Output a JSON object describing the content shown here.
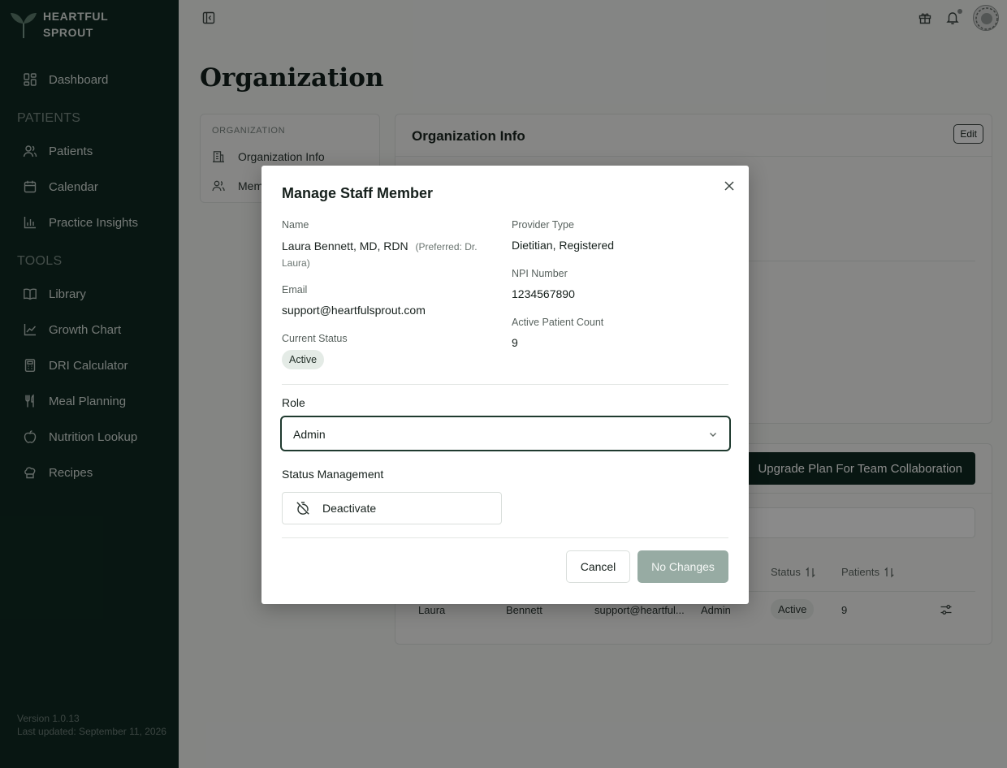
{
  "brand": {
    "line1": "HEARTFUL",
    "line2": "SPROUT"
  },
  "sidebar": {
    "dashboard": "Dashboard",
    "patients_section": "PATIENTS",
    "patients": "Patients",
    "calendar": "Calendar",
    "insights": "Practice Insights",
    "tools_section": "TOOLS",
    "library": "Library",
    "growth": "Growth Chart",
    "dri": "DRI Calculator",
    "meal": "Meal Planning",
    "nutrition": "Nutrition Lookup",
    "recipes": "Recipes",
    "version": "Version 1.0.13",
    "updated": "Last updated: September 11, 2026"
  },
  "page": {
    "title": "Organization"
  },
  "left_panel": {
    "section": "ORGANIZATION",
    "item1": "Organization Info",
    "item2": "Mem"
  },
  "info_panel": {
    "title": "Organization Info",
    "edit": "Edit"
  },
  "members": {
    "upgrade": "Upgrade Plan For Team Collaboration",
    "col_status": "Status",
    "col_patients": "Patients",
    "row": {
      "first": "Laura",
      "last": "Bennett",
      "email": "support@heartful...",
      "role": "Admin",
      "status": "Active",
      "patients": "9"
    }
  },
  "modal": {
    "title": "Manage Staff Member",
    "name_label": "Name",
    "name_value": "Laura Bennett, MD, RDN",
    "preferred": "(Preferred: Dr. Laura)",
    "provider_label": "Provider Type",
    "provider_value": "Dietitian, Registered",
    "email_label": "Email",
    "email_value": "support@heartfulsprout.com",
    "npi_label": "NPI Number",
    "npi_value": "1234567890",
    "status_label": "Current Status",
    "status_value": "Active",
    "count_label": "Active Patient Count",
    "count_value": "9",
    "role_label": "Role",
    "role_value": "Admin",
    "status_mgmt_label": "Status Management",
    "deactivate": "Deactivate",
    "cancel": "Cancel",
    "save": "No Changes"
  }
}
